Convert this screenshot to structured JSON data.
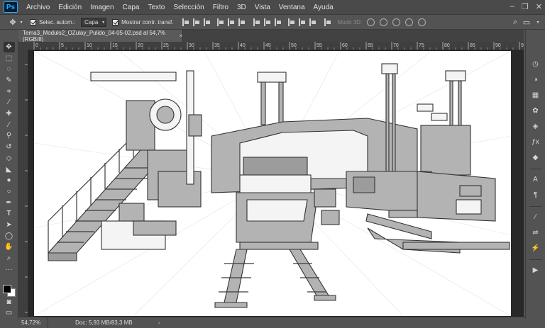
{
  "app": {
    "logo": "Ps"
  },
  "menu": [
    "Archivo",
    "Edición",
    "Imagen",
    "Capa",
    "Texto",
    "Selección",
    "Filtro",
    "3D",
    "Vista",
    "Ventana",
    "Ayuda"
  ],
  "options": {
    "auto_select_label": "Selec. autom.:",
    "auto_select_target": "Capa",
    "transform_label": "Mostrar contr. transf.",
    "mode3d_label": "Modo 3D:"
  },
  "document": {
    "tab_title": "Tema3_Modulo2_OZulay_Pulido_04-05-02.psd al 54,7% (RGB/8)",
    "close_glyph": "×"
  },
  "status": {
    "zoom": "54,72%",
    "doc_info": "Doc: 5,93 MB/83,3 MB",
    "arrow": "›"
  },
  "ruler_h_ticks": [
    "0",
    "5",
    "10",
    "15",
    "20",
    "25",
    "30",
    "35",
    "40",
    "45",
    "50",
    "55",
    "60",
    "65",
    "70",
    "75",
    "80",
    "85",
    "90",
    "95"
  ],
  "icons": {
    "tools": [
      "move-icon",
      "marquee-icon",
      "lasso-icon",
      "quick-select-icon",
      "crop-icon",
      "eyedropper-icon",
      "healing-brush-icon",
      "brush-icon",
      "clone-stamp-icon",
      "history-brush-icon",
      "eraser-icon",
      "paint-bucket-icon",
      "blur-icon",
      "dodge-icon",
      "pen-icon",
      "type-icon",
      "path-select-icon",
      "shape-icon",
      "hand-icon",
      "zoom-icon",
      "more-tools-icon"
    ],
    "dock": [
      "history-icon",
      "color-icon",
      "swatches-icon",
      "adjustments-icon",
      "styles-icon",
      "layers-icon",
      "paragraph-icon",
      "character-icon",
      "brush-settings-icon",
      "properties-icon",
      "actions-icon",
      "play-icon"
    ]
  },
  "colors": {
    "foreground": "#000000",
    "background": "#ffffff",
    "accent": "#31a8ff"
  }
}
